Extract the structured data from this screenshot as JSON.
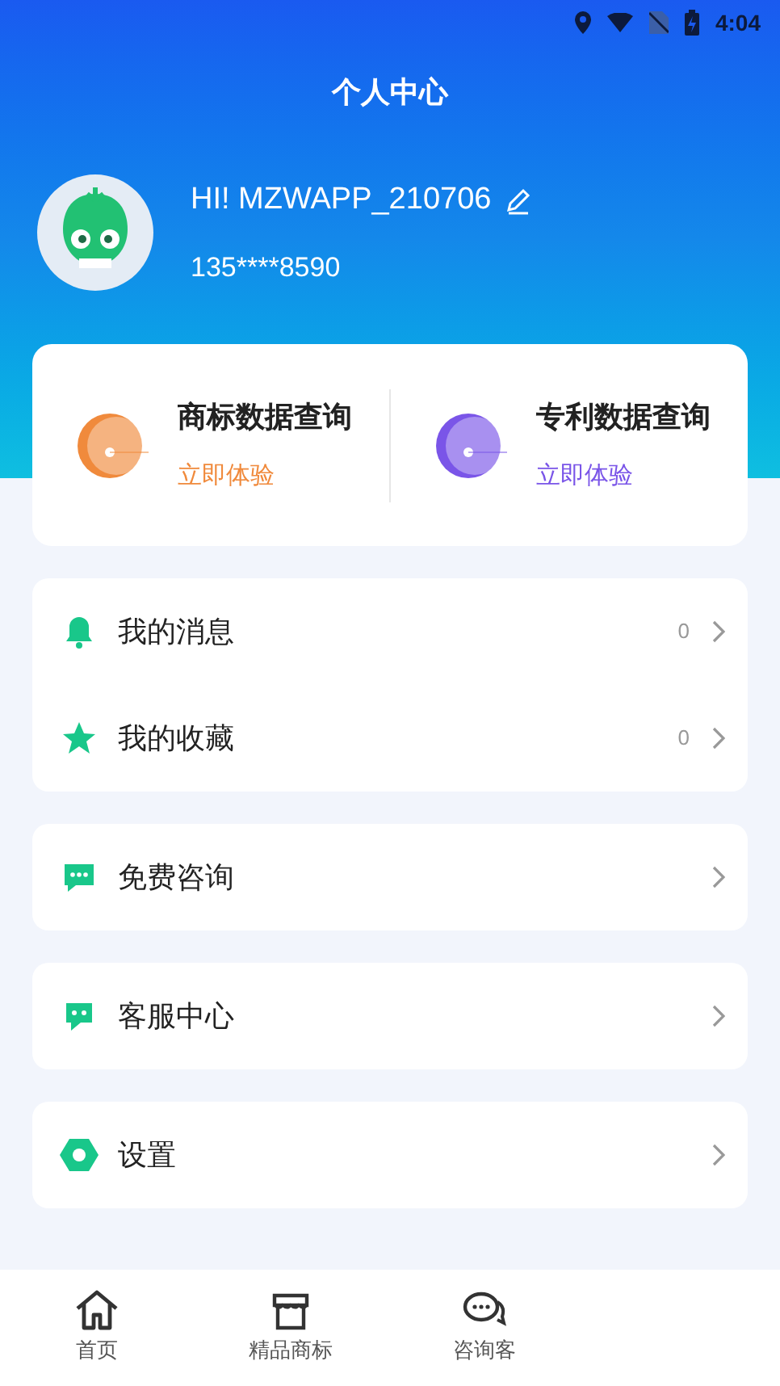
{
  "status_bar": {
    "time": "4:04"
  },
  "title": "个人中心",
  "profile": {
    "name": "HI! MZWAPP_210706",
    "phone": "135****8590"
  },
  "query_cards": [
    {
      "title": "商标数据查询",
      "action": "立即体验",
      "color": "#f08a3c"
    },
    {
      "title": "专利数据查询",
      "action": "立即体验",
      "color": "#7a55e8"
    }
  ],
  "menu_groups": [
    [
      {
        "kind": "bell",
        "label": "我的消息",
        "count": "0"
      },
      {
        "kind": "star",
        "label": "我的收藏",
        "count": "0"
      }
    ],
    [
      {
        "kind": "chat",
        "label": "免费咨询"
      }
    ],
    [
      {
        "kind": "service",
        "label": "客服中心"
      }
    ],
    [
      {
        "kind": "settings",
        "label": "设置"
      }
    ]
  ],
  "bottom_nav": [
    {
      "kind": "home",
      "label": "首页"
    },
    {
      "kind": "shop",
      "label": "精品商标"
    },
    {
      "kind": "consult",
      "label": "咨询客"
    }
  ]
}
